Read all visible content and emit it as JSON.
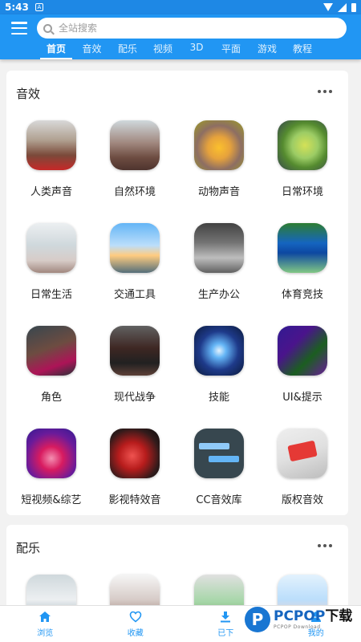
{
  "status_bar": {
    "time": "5:43",
    "notification": "A"
  },
  "search": {
    "placeholder": "全站搜索"
  },
  "tabs": [
    {
      "label": "首页",
      "active": true
    },
    {
      "label": "音效"
    },
    {
      "label": "配乐"
    },
    {
      "label": "视频"
    },
    {
      "label": "3D"
    },
    {
      "label": "平面"
    },
    {
      "label": "游戏"
    },
    {
      "label": "教程"
    }
  ],
  "sections": [
    {
      "title": "音效",
      "items": [
        {
          "label": "人类声音",
          "icon": "crowd-image"
        },
        {
          "label": "自然环境",
          "icon": "mountain-image"
        },
        {
          "label": "动物声音",
          "icon": "lion-image"
        },
        {
          "label": "日常环境",
          "icon": "tennis-ball-image"
        },
        {
          "label": "日常生活",
          "icon": "faucet-image"
        },
        {
          "label": "交通工具",
          "icon": "airplane-image"
        },
        {
          "label": "生产办公",
          "icon": "office-image"
        },
        {
          "label": "体育竞技",
          "icon": "runners-image"
        },
        {
          "label": "角色",
          "icon": "warrior-image"
        },
        {
          "label": "现代战争",
          "icon": "soldiers-image"
        },
        {
          "label": "技能",
          "icon": "magic-orb-image"
        },
        {
          "label": "UI&提示",
          "icon": "game-ui-image"
        },
        {
          "label": "短视频&综艺",
          "icon": "neon-stage-image"
        },
        {
          "label": "影视特效音",
          "icon": "red-fx-image"
        },
        {
          "label": "CC音效库",
          "icon": "chat-bubbles-image"
        },
        {
          "label": "版权音效",
          "icon": "copyright-keyboard-image"
        }
      ]
    },
    {
      "title": "配乐",
      "items": [
        {
          "icon": "snow-landscape-image"
        },
        {
          "icon": "chef-image"
        },
        {
          "icon": "hills-image"
        },
        {
          "icon": "thumbs-up-image"
        }
      ]
    }
  ],
  "bottom_nav": [
    {
      "label": "浏览",
      "icon": "home-icon"
    },
    {
      "label": "收藏",
      "icon": "heart-icon"
    },
    {
      "label": "已下",
      "icon": "download-icon"
    },
    {
      "label": "我的",
      "icon": "user-icon"
    }
  ],
  "watermark": {
    "logo": "P",
    "brand": "PCPOP",
    "suffix": "下载",
    "tagline": "PCPOP Download"
  },
  "colors": {
    "primary": "#2196f3",
    "statusbar": "#1e88e5"
  }
}
